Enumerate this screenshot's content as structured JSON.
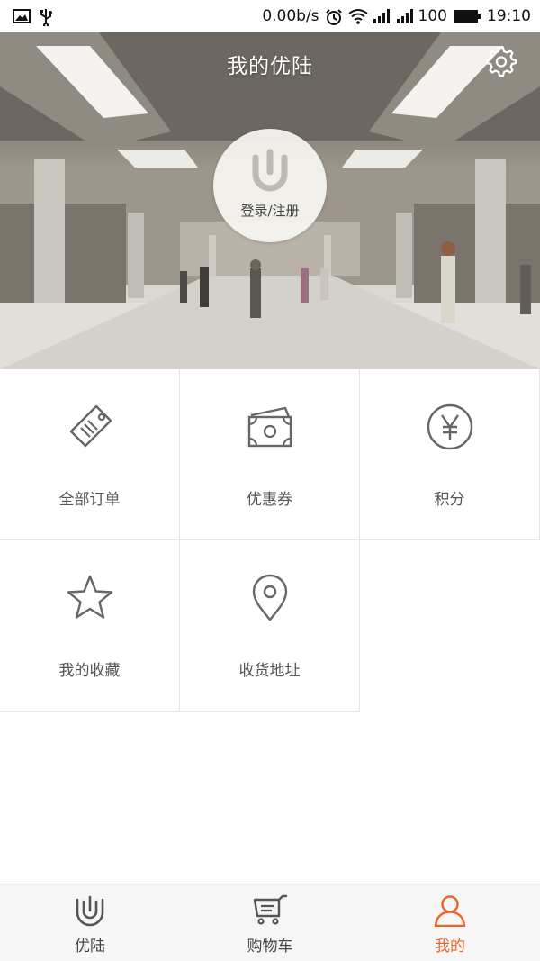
{
  "status_bar": {
    "speed": "0.00b/s",
    "battery": "100",
    "time": "19:10"
  },
  "header": {
    "title": "我的优陆"
  },
  "login": {
    "label": "登录/注册"
  },
  "menu": [
    {
      "label": "全部订单",
      "icon": "tag-icon"
    },
    {
      "label": "优惠券",
      "icon": "coupon-icon"
    },
    {
      "label": "积分",
      "icon": "yen-icon"
    },
    {
      "label": "我的收藏",
      "icon": "star-icon"
    },
    {
      "label": "收货地址",
      "icon": "location-pin-icon"
    }
  ],
  "tabs": [
    {
      "label": "优陆",
      "icon": "youlu-logo-icon"
    },
    {
      "label": "购物车",
      "icon": "cart-icon"
    },
    {
      "label": "我的",
      "icon": "person-icon",
      "active": true
    }
  ],
  "colors": {
    "accent": "#e8662a",
    "icon_gray": "#666666",
    "text_gray": "#555555"
  }
}
